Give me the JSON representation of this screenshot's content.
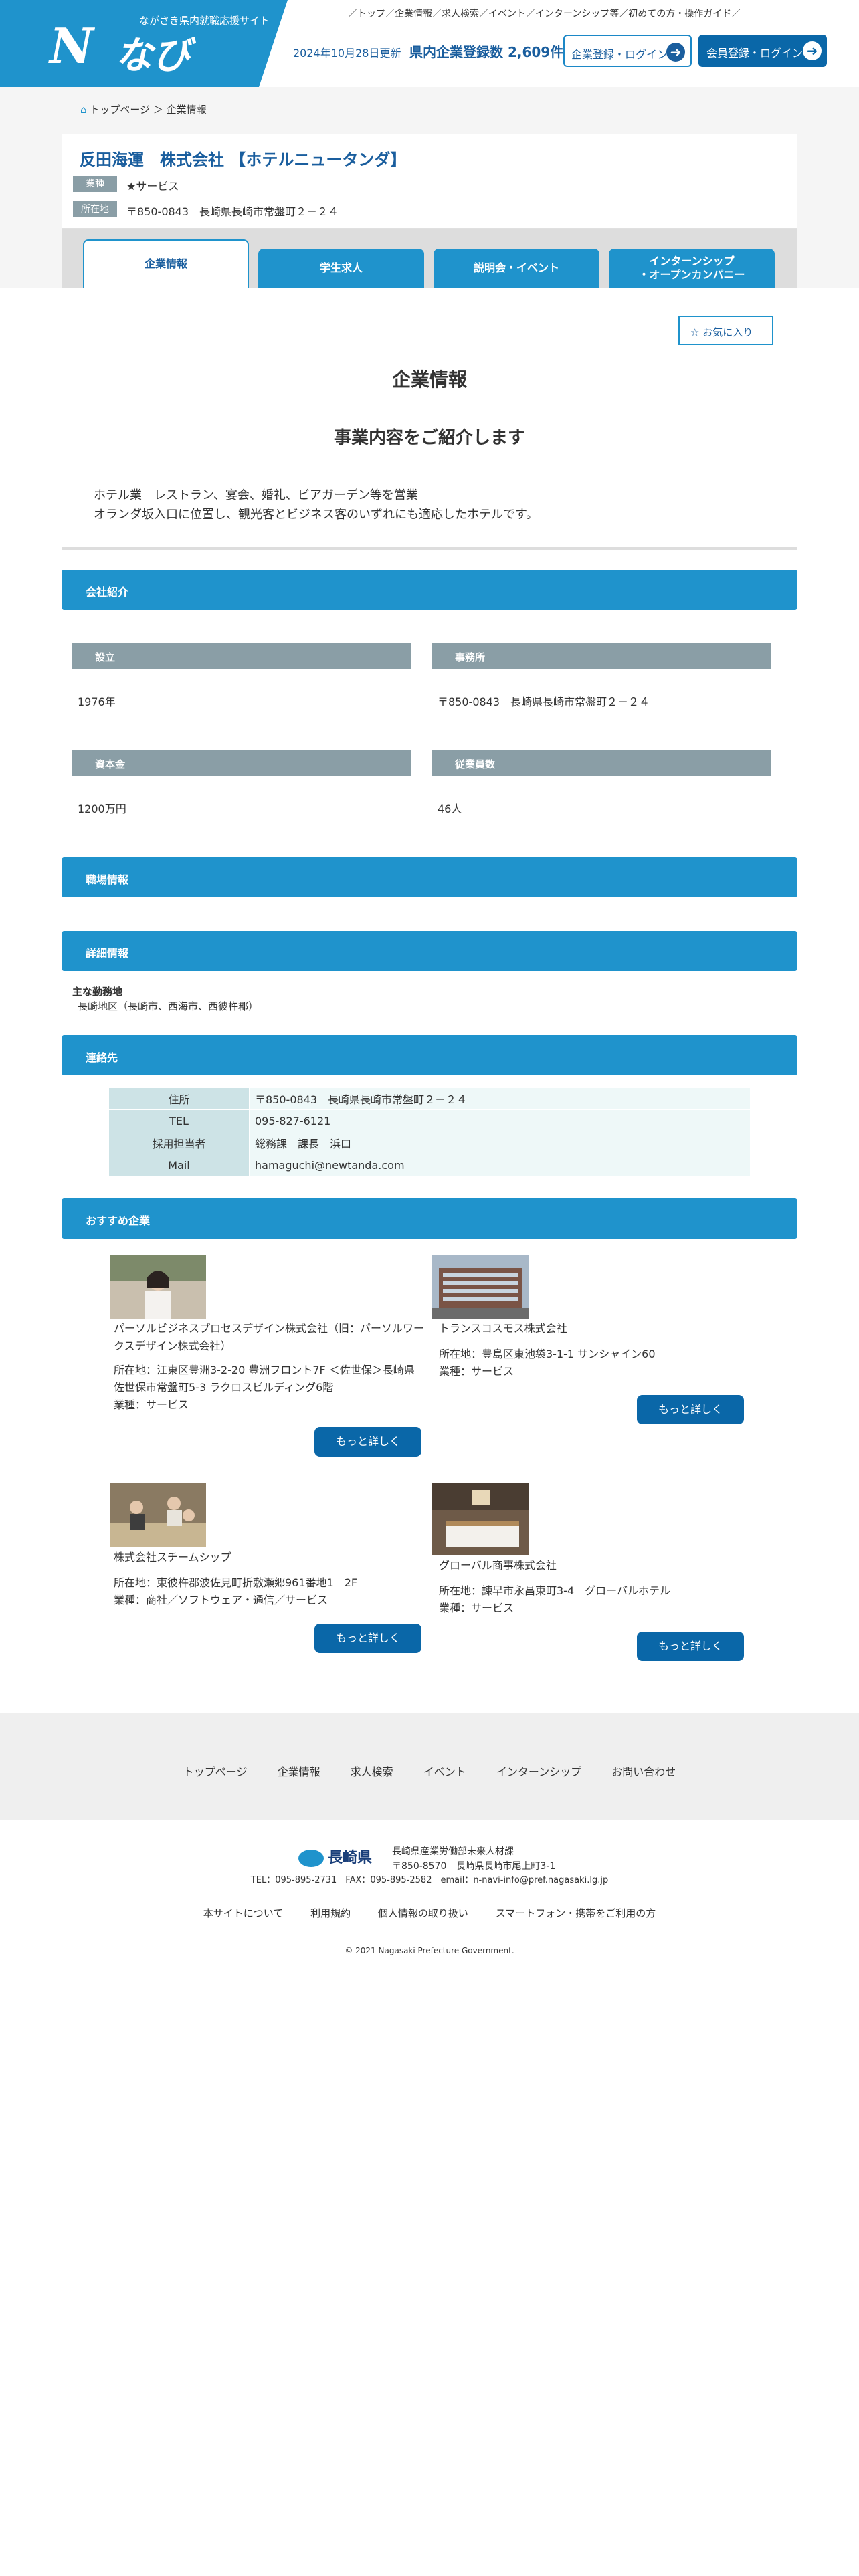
{
  "header": {
    "site_tagline": "ながさき県内就職応援サイト",
    "logo_mark": "N",
    "logo_name": "なび",
    "top_nav": [
      "／トップ／",
      "企業情報",
      "／求人検索",
      "／イベント",
      "／インターンシップ等",
      "／初めての方・操作ガイド／"
    ],
    "updated": "2024年10月28日更新",
    "count_text": "県内企業登録数 2,609件",
    "corp_login": "企業登録・ログイン",
    "member_login": "会員登録・ログイン"
  },
  "breadcrumb": {
    "home": "トップページ",
    "sep": "＞",
    "current": "企業情報"
  },
  "company": {
    "name": "反田海運　株式会社 【ホテルニュータンダ】",
    "industry_tag": "業種",
    "industry": "★サービス",
    "address_tag": "所在地",
    "address": "〒850-0843　長崎県長崎市常盤町２－２４"
  },
  "tabs": [
    {
      "label": "企業情報",
      "active": true
    },
    {
      "label": "学生求人",
      "active": false
    },
    {
      "label": "説明会・イベント",
      "active": false
    },
    {
      "label": "インターンシップ\n・オープンカンパニー",
      "active": false
    }
  ],
  "favorite_label": "お気に入り",
  "page_title": "企業情報",
  "page_subtitle": "事業内容をご紹介します",
  "intro_lines": [
    "ホテル業　レストラン、宴会、婚礼、ビアガーデン等を営業",
    "オランダ坂入口に位置し、観光客とビジネス客のいずれにも適応したホテルです。"
  ],
  "sections": {
    "company_intro": "会社紹介",
    "workplace": "職場情報",
    "details": "詳細情報",
    "contact": "連絡先",
    "recommend": "おすすめ企業"
  },
  "company_intro": {
    "founded_label": "設立",
    "founded": "1976年",
    "office_label": "事務所",
    "office": "〒850-0843　長崎県長崎市常盤町２－２４",
    "capital_label": "資本金",
    "capital": "1200万円",
    "employees_label": "従業員数",
    "employees": "46人"
  },
  "details": {
    "location_label": "主な勤務地",
    "location": "長崎地区（長崎市、西海市、西彼杵郡）"
  },
  "contact": [
    {
      "k": "住所",
      "v": "〒850-0843　長崎県長崎市常盤町２－２４"
    },
    {
      "k": "TEL",
      "v": "095-827-6121"
    },
    {
      "k": "採用担当者",
      "v": "総務課　課長　浜口"
    },
    {
      "k": "Mail",
      "v": "hamaguchi@newtanda.com"
    }
  ],
  "recommend": [
    {
      "name": "パーソルビジネスプロセスデザイン株式会社（旧：パーソルワークスデザイン株式会社）",
      "address": "所在地：江東区豊洲3-2-20 豊洲フロント7F ＜佐世保＞長崎県佐世保市常盤町5-3 ラクロスビルディング6階",
      "industry": "業種：サービス",
      "more": "もっと詳しく"
    },
    {
      "name": "トランスコスモス株式会社",
      "address": "所在地：豊島区東池袋3-1-1 サンシャイン60",
      "industry": "業種：サービス",
      "more": "もっと詳しく"
    },
    {
      "name": "株式会社スチームシップ",
      "address": "所在地：東彼杵郡波佐見町折敷瀬郷961番地1　2F",
      "industry": "業種：商社／ソフトウェア・通信／サービス",
      "more": "もっと詳しく"
    },
    {
      "name": "グローバル商事株式会社",
      "address": "所在地：諫早市永昌東町3-4　グローバルホテル",
      "industry": "業種：サービス",
      "more": "もっと詳しく"
    }
  ],
  "footer": {
    "nav": [
      "トップページ",
      "企業情報",
      "求人検索",
      "イベント",
      "インターンシップ",
      "お問い合わせ"
    ],
    "pref_logo": "長崎県",
    "dept": "長崎県産業労働部未来人材課",
    "address": "〒850-8570　長崎県長崎市尾上町3-1",
    "contact": "TEL：095-895-2731　FAX：095-895-2582　email：n-navi-info@pref.nagasaki.lg.jp",
    "links": [
      "本サイトについて",
      "利用規約",
      "個人情報の取り扱い",
      "スマートフォン・携帯をご利用の方"
    ],
    "copyright": "© 2021 Nagasaki Prefecture Government."
  }
}
